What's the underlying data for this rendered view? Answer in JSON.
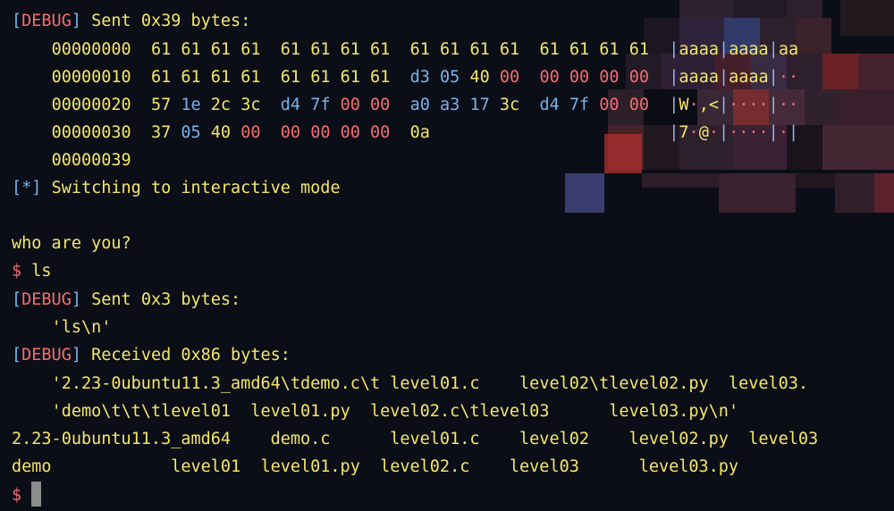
{
  "terminal": {
    "debug_label": "DEBUG",
    "info_label": "*",
    "sent_header": "Sent 0x39 bytes:",
    "hexdump": {
      "offsets": [
        "00000000",
        "00000010",
        "00000020",
        "00000030",
        "00000039"
      ],
      "row0_bytes": [
        "61",
        "61",
        "61",
        "61",
        "61",
        "61",
        "61",
        "61",
        "61",
        "61",
        "61",
        "61",
        "61",
        "61",
        "61",
        "61"
      ],
      "row0_ascii": "|aaaa|aaaa|aa",
      "row1_bytes": [
        "61",
        "61",
        "61",
        "61",
        "61",
        "61",
        "61",
        "61",
        "d3",
        "05",
        "40",
        "00",
        "00",
        "00",
        "00",
        "00"
      ],
      "row1_ascii": "|aaaa|aaaa|··",
      "row2_bytes": [
        "57",
        "1e",
        "2c",
        "3c",
        "d4",
        "7f",
        "00",
        "00",
        "a0",
        "a3",
        "17",
        "3c",
        "d4",
        "7f",
        "00",
        "00"
      ],
      "row2_ascii": "|W·,<|····|··",
      "row3_bytes": [
        "37",
        "05",
        "40",
        "00",
        "00",
        "00",
        "00",
        "00",
        "0a"
      ],
      "row3_ascii": "|7·@·|····|·|"
    },
    "interactive_msg": "Switching to interactive mode",
    "who_prompt": "who are you?",
    "shell_prompt": "$",
    "command": "ls",
    "sent_ls_header": "Sent 0x3 bytes:",
    "sent_ls_payload": "'ls\\n'",
    "received_header": "Received 0x86 bytes:",
    "received_line1": "'2.23-0ubuntu11.3_amd64\\tdemo.c\\t level01.c    level02\\tlevel02.py  level03.",
    "received_line2": "'demo\\t\\t\\tlevel01  level01.py  level02.c\\tlevel03      level03.py\\n'",
    "listing_line1": "2.23-0ubuntu11.3_amd64    demo.c      level01.c    level02    level02.py  level03",
    "listing_line2": "demo            level01  level01.py  level02.c    level03      level03.py",
    "final_prompt": "$"
  }
}
